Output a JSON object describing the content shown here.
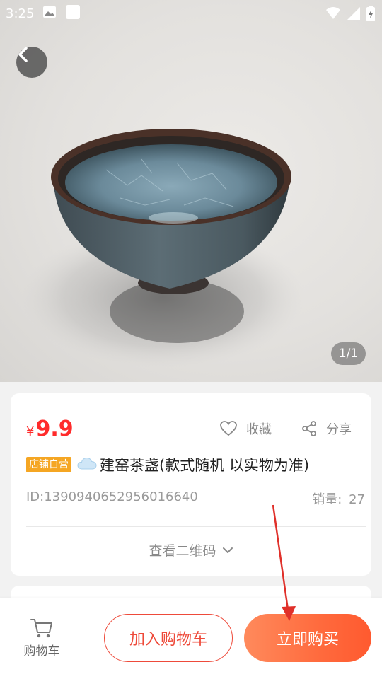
{
  "status_bar": {
    "time": "3:25"
  },
  "gallery": {
    "page_indicator": "1/1"
  },
  "product": {
    "price_currency": "¥",
    "price": "9.9",
    "favorite_label": "收藏",
    "share_label": "分享",
    "badge": "店铺自营",
    "title": "建窑茶盏(款式随机  以实物为准)",
    "id_text": "ID:1390940652956016640",
    "sales_label": "销量:",
    "sales_value": "27",
    "qr_label": "查看二维码"
  },
  "bottom_bar": {
    "cart_label": "购物车",
    "add_to_cart_label": "加入购物车",
    "buy_now_label": "立即购买"
  },
  "colors": {
    "accent": "#ff2b2b",
    "button_gradient_start": "#ff8a5c",
    "button_gradient_end": "#ff5a2f",
    "badge": "#f5a623"
  },
  "icons": [
    "back-arrow-icon",
    "heart-icon",
    "share-icon",
    "chevron-down-icon",
    "cart-icon",
    "cloud-icon",
    "wifi-icon",
    "battery-icon",
    "image-icon"
  ]
}
